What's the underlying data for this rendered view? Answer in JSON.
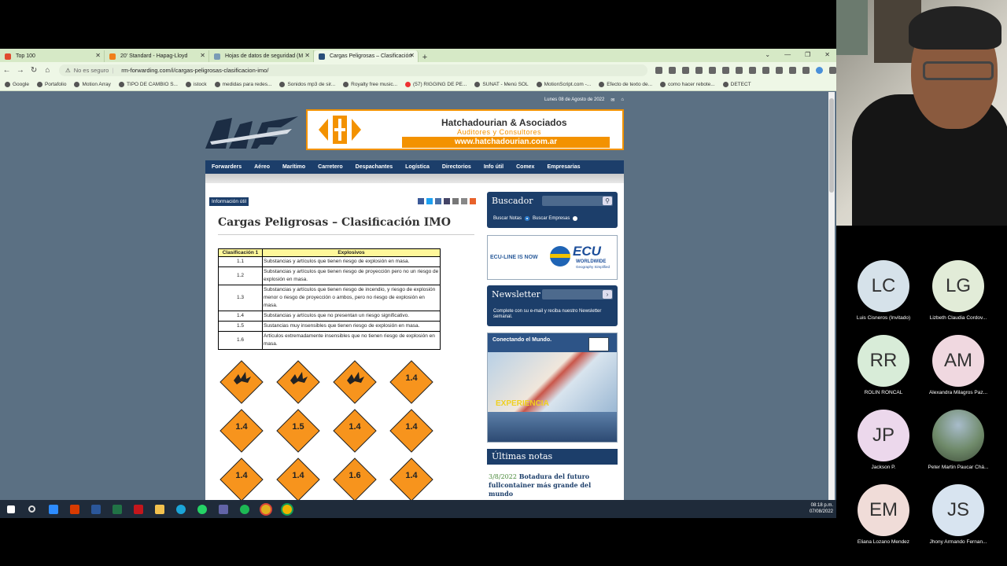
{
  "browser": {
    "tabs": [
      {
        "label": "Top 100",
        "fav_color": "#e04a2e"
      },
      {
        "label": "20' Standard - Hapag-Lloyd",
        "fav_color": "#f07f1a"
      },
      {
        "label": "Hojas de datos de seguridad (M",
        "fav_color": "#7a9bb6"
      },
      {
        "label": "Cargas Peligrosas – Clasificación",
        "fav_color": "#2b4f7a"
      }
    ],
    "security": "No es seguro",
    "url": "rm-forwarding.com/i/cargas-peligrosas-clasificacion-imo/",
    "bookmarks": [
      "Google",
      "Portafolio",
      "Motion Array",
      "TIPO DE CAMBIO S...",
      "istock",
      "medidas para redes...",
      "Sonidos mp3 de sir...",
      "Royalty free music...",
      "(57) RIGGING DE PE...",
      "SUNAT - Menú SOL",
      "MotionScript.com -...",
      "Efecto de texto de...",
      "como hacer rebote...",
      "DETECT"
    ]
  },
  "site": {
    "date": "Lunes 08 de Agosto de 2022",
    "banner": {
      "name": "Hatchadourian & Asociados",
      "tagline": "Auditores y Consultores",
      "url": "www.hatchadourian.com.ar"
    },
    "nav": [
      "Forwarders",
      "Aéreo",
      "Marítimo",
      "Carretero",
      "Despachantes",
      "Logística",
      "Directorios",
      "Info útil",
      "Comex",
      "Empresarias"
    ],
    "tag": "Información útil",
    "title": "Cargas Peligrosas – Clasificación IMO",
    "table": {
      "headers": [
        "Clasificación 1",
        "Explosivos"
      ],
      "rows": [
        [
          "1.1",
          "Substancias y artículos que tienen riesgo de explosión en masa."
        ],
        [
          "1.2",
          "Substancias y artículos que tienen riesgo de proyección pero no un riesgo de explosión en masa."
        ],
        [
          "1.3",
          "Substancias y artículos que tienen riesgo de incendio, y riesgo de explosión menor o riesgo de proyección o ambos, pero no riesgo de explosión en masa."
        ],
        [
          "1.4",
          "Substancias y artículos que no presentan un riesgo significativo."
        ],
        [
          "1.5",
          "Sustancias muy insensibles que tienen riesgo de explosión en masa."
        ],
        [
          "1.6",
          "Artículos extremadamente insensibles que no tienen riesgo de explosión en masa."
        ]
      ]
    },
    "labels": [
      "1.1",
      "1.2",
      "1.3",
      "1.4",
      "1.4",
      "1.5",
      "1.4",
      "1.4",
      "1.4",
      "1.4",
      "1.6",
      "1.4"
    ],
    "sidebar": {
      "buscador": "Buscador",
      "radio1": "Buscar Notas",
      "radio2": "Buscar Empresas",
      "ecu_line": "ECU-LINE IS NOW",
      "ecu_brand": "ECU",
      "ecu_sub": "WORLDWIDE",
      "ecu_tag": "Geography Simplified",
      "newsletter": "Newsletter",
      "newsletter_desc": "Complete con su e-mail y reciba nuestro Newsletter semanal.",
      "ad_title": "Conectando el Mundo.",
      "ad_text": "EXPERIENCIA",
      "ultimas": "Últimas notas",
      "nota_date": "3/8/2022",
      "nota_title": "Botadura del futuro fullcontainer más grande del mundo"
    }
  },
  "taskbar": {
    "time": "08:18 p.m.",
    "date": "07/08/2022"
  },
  "participants": [
    {
      "initials": "LC",
      "name": "Luis Cisneros (Invitado)",
      "color": "#d6e2ea"
    },
    {
      "initials": "LG",
      "name": "Lizbeth Claudia Cordov...",
      "color": "#e2ecd8"
    },
    {
      "initials": "RR",
      "name": "ROLIN RONCAL",
      "color": "#d8ecd8"
    },
    {
      "initials": "AM",
      "name": "Alexandra Milagros Paz...",
      "color": "#f0d8e0"
    },
    {
      "initials": "JP",
      "name": "Jackson P.",
      "color": "#ecd8ec"
    },
    {
      "initials": "",
      "name": "Peter Martin Paucar Chá...",
      "color": "#6f8a6a"
    },
    {
      "initials": "EM",
      "name": "Eliana Lozano Mendez",
      "color": "#f0dcd8"
    },
    {
      "initials": "JS",
      "name": "Jhony Armando Fernan...",
      "color": "#d8e4f0"
    }
  ]
}
